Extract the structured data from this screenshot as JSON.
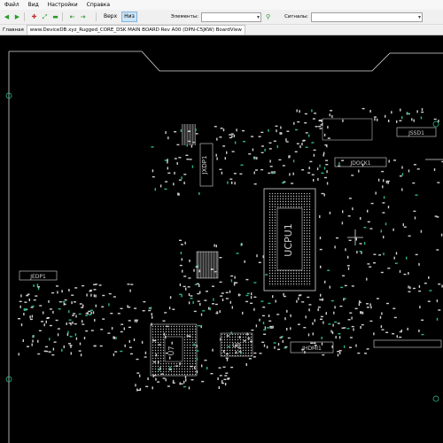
{
  "menu": {
    "items": [
      "Файл",
      "Вид",
      "Настройки",
      "Справка"
    ]
  },
  "toolbar": {
    "view_top_label": "Верх",
    "view_bottom_label": "Низ",
    "elements_label": "Элементы:",
    "elements_value": "",
    "signals_label": "Сигналы:",
    "signals_value": ""
  },
  "tabs": {
    "home_label": "Главная",
    "file_label": "www.DeviceDB.xyz_Rugged_CORE_DSK MAIN BOARD Rev A00 (DPN-C5JKW) BoardView"
  },
  "board": {
    "labels": {
      "cpu": "UCPU1",
      "jxdp1": "JXDP1",
      "jdock1": "JDOCK1",
      "jhdmi1": "JHDMI1",
      "u7": "U7",
      "u9": "U9",
      "jeddp1": "JEDP1",
      "jssd1": "JSSD1"
    },
    "colors": {
      "background": "#000000",
      "outline": "#d8d8d8",
      "silk": "#cfcfcf",
      "via": "#2bb88f",
      "cursor": "#e0e0e0"
    }
  }
}
